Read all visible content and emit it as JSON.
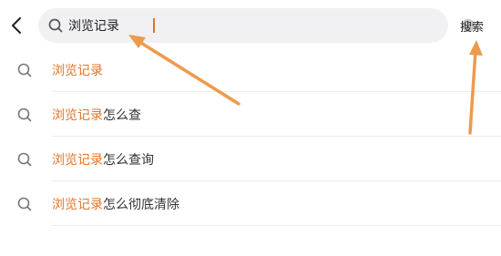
{
  "header": {
    "search_value": "浏览记录",
    "search_button_label": "搜索"
  },
  "suggestions": [
    {
      "highlight": "浏览记录",
      "rest": ""
    },
    {
      "highlight": "浏览记录",
      "rest": "怎么查"
    },
    {
      "highlight": "浏览记录",
      "rest": "怎么查询"
    },
    {
      "highlight": "浏览记录",
      "rest": "怎么彻底清除"
    }
  ],
  "colors": {
    "highlight": "#e07628",
    "annotation_arrow": "#ee9a4d"
  },
  "icons": {
    "back": "chevron-left-icon",
    "search": "search-icon",
    "clear": "clear-icon"
  }
}
